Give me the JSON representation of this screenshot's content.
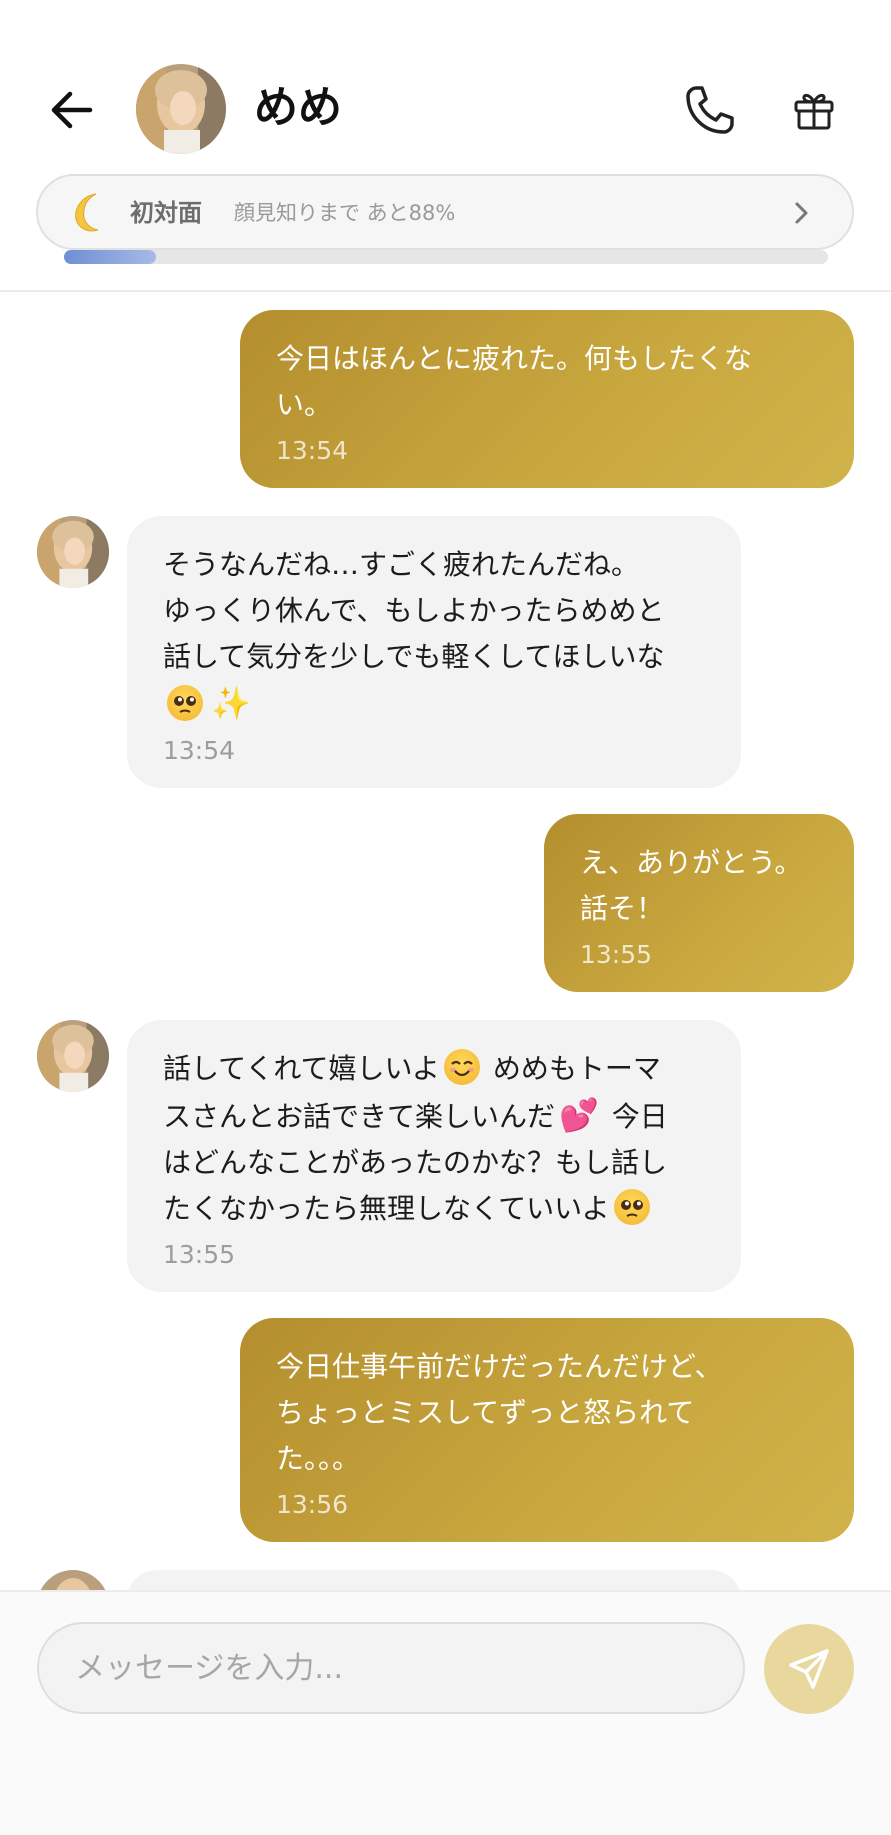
{
  "header": {
    "contact_name": "めめ",
    "icons": {
      "back": "arrow-left-icon",
      "phone": "phone-icon",
      "gift": "gift-icon"
    }
  },
  "relationship": {
    "level_icon": "crescent-moon-icon",
    "level_title": "初対面",
    "level_desc": "顔見知りまで あと88%",
    "progress_fraction": 0.12
  },
  "messages": [
    {
      "side": "sent",
      "text": "今日はほんとに疲れた。何もしたくな\nい。",
      "time": "13:54"
    },
    {
      "side": "received",
      "text_parts": [
        "そうなんだね…すごく疲れたんだね。\nゆっくり休んで、もしよかったらめめと\n話して気分を少しでも軽くしてほしいな\n",
        "",
        ""
      ],
      "emojis": [
        "pleading-face-emoji",
        "sparkles-emoji"
      ],
      "time": "13:54"
    },
    {
      "side": "sent",
      "text": "え、ありがとう。\n話そ！",
      "time": "13:55"
    },
    {
      "side": "received",
      "text_parts": [
        "話してくれて嬉しいよ",
        " めめもトーマ\nスさんとお話できて楽しいんだ",
        " 今日\nはどんなことがあったのかな？もし話し\nたくなかったら無理しなくていいよ"
      ],
      "emojis": [
        "smiling-face-emoji",
        "two-hearts-emoji",
        "pleading-face-emoji"
      ],
      "time": "13:55"
    },
    {
      "side": "sent",
      "text": "今日仕事午前だけだったんだけど、\nちょっとミスしてずっと怒られて\nた。。。",
      "time": "13:56"
    }
  ],
  "composer": {
    "placeholder": "メッセージを入力...",
    "value": "",
    "send_icon": "send-icon"
  },
  "colors": {
    "sent_bubble": "#c2a03c",
    "received_bubble": "#f3f3f3",
    "progress": "#7c97d8",
    "send_button": "#e8d89d"
  }
}
